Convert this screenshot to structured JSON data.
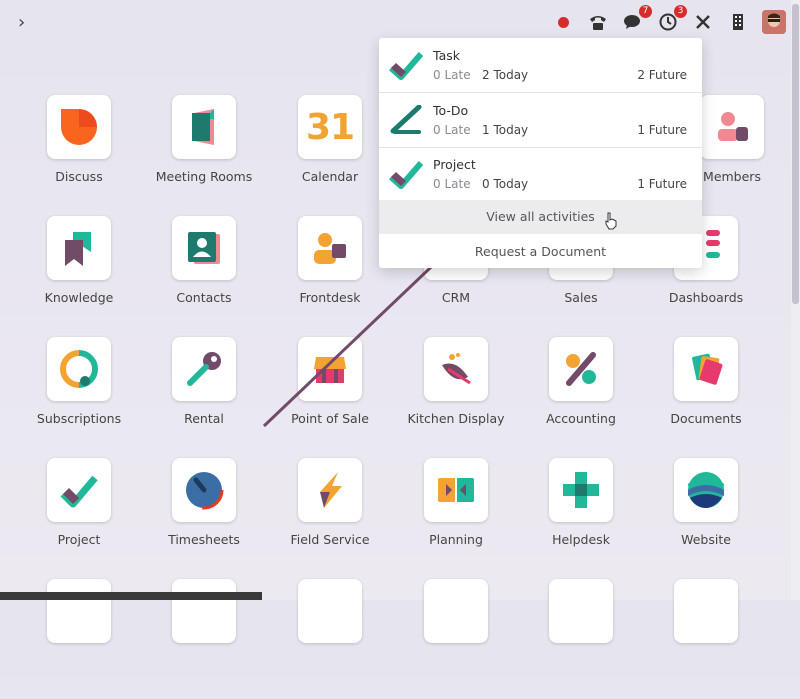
{
  "topbar": {
    "menu_icon": "chevron-right-icon",
    "icons": [
      "record-icon",
      "phone-icon",
      "chat-icon",
      "clock-icon",
      "tools-icon",
      "building-icon",
      "avatar"
    ],
    "messages_badge": "7",
    "activities_badge": "3"
  },
  "apps": [
    {
      "label": "Discuss"
    },
    {
      "label": "Meeting Rooms"
    },
    {
      "label": "Calendar"
    },
    {
      "label": ""
    },
    {
      "label": ""
    },
    {
      "label": "Members"
    },
    {
      "label": "Knowledge"
    },
    {
      "label": "Contacts"
    },
    {
      "label": "Frontdesk"
    },
    {
      "label": "CRM"
    },
    {
      "label": "Sales"
    },
    {
      "label": "Dashboards"
    },
    {
      "label": "Subscriptions"
    },
    {
      "label": "Rental"
    },
    {
      "label": "Point of Sale"
    },
    {
      "label": "Kitchen Display"
    },
    {
      "label": "Accounting"
    },
    {
      "label": "Documents"
    },
    {
      "label": "Project"
    },
    {
      "label": "Timesheets"
    },
    {
      "label": "Field Service"
    },
    {
      "label": "Planning"
    },
    {
      "label": "Helpdesk"
    },
    {
      "label": "Website"
    }
  ],
  "calendar_tile_text": "31",
  "activities": [
    {
      "name": "Task",
      "late": "0 Late",
      "today": "2 Today",
      "future": "2 Future"
    },
    {
      "name": "To-Do",
      "late": "0 Late",
      "today": "1 Today",
      "future": "1 Future"
    },
    {
      "name": "Project",
      "late": "0 Late",
      "today": "0 Today",
      "future": "1 Future"
    }
  ],
  "view_all": "View all activities",
  "request_document": "Request a Document",
  "colors": {
    "accent_purple": "#714b67",
    "teal": "#21b799",
    "red": "#d62c2c"
  }
}
